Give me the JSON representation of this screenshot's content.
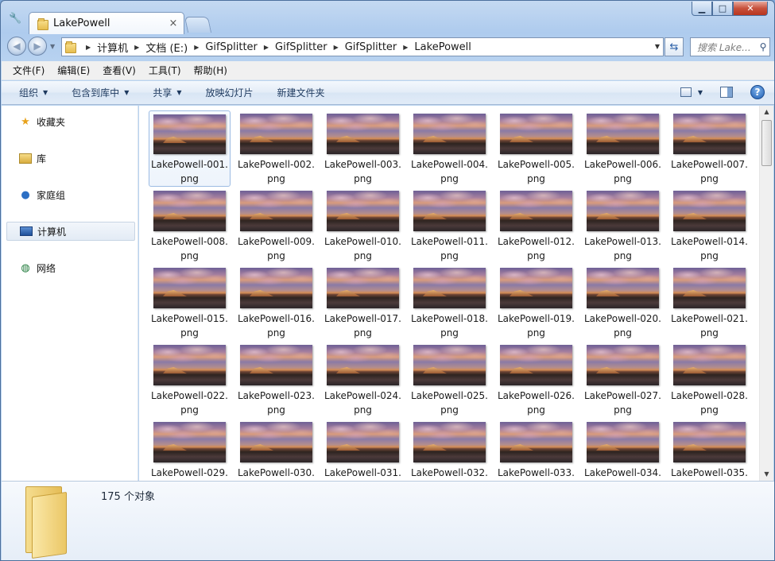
{
  "window": {
    "tab_title": "LakePowell",
    "tab_close": "×",
    "controls": {
      "minimize": "▁",
      "maximize": "□",
      "close": "✕"
    }
  },
  "address": {
    "crumbs": [
      "计算机",
      "文档 (E:)",
      "GifSplitter",
      "GifSplitter",
      "GifSplitter",
      "LakePowell"
    ],
    "search_placeholder": "搜索 Lake..."
  },
  "menu": [
    "文件(F)",
    "编辑(E)",
    "查看(V)",
    "工具(T)",
    "帮助(H)"
  ],
  "commands": [
    {
      "label": "组织",
      "dropdown": true
    },
    {
      "label": "包含到库中",
      "dropdown": true
    },
    {
      "label": "共享",
      "dropdown": true
    },
    {
      "label": "放映幻灯片",
      "dropdown": false
    },
    {
      "label": "新建文件夹",
      "dropdown": false
    }
  ],
  "sidebar": {
    "items": [
      {
        "label": "收藏夹",
        "icon": "star-icon"
      },
      {
        "label": "库",
        "icon": "library-icon"
      },
      {
        "label": "家庭组",
        "icon": "homegroup-icon"
      },
      {
        "label": "计算机",
        "icon": "computer-icon",
        "selected": true
      },
      {
        "label": "网络",
        "icon": "network-icon"
      }
    ]
  },
  "files": {
    "prefix": "LakePowell-",
    "ext_line": "png",
    "names": [
      "LakePowell-001.",
      "LakePowell-002.",
      "LakePowell-003.",
      "LakePowell-004.",
      "LakePowell-005.",
      "LakePowell-006.",
      "LakePowell-007.",
      "LakePowell-008.",
      "LakePowell-009.",
      "LakePowell-010.",
      "LakePowell-011.",
      "LakePowell-012.",
      "LakePowell-013.",
      "LakePowell-014.",
      "LakePowell-015.",
      "LakePowell-016.",
      "LakePowell-017.",
      "LakePowell-018.",
      "LakePowell-019.",
      "LakePowell-020.",
      "LakePowell-021.",
      "LakePowell-022.",
      "LakePowell-023.",
      "LakePowell-024.",
      "LakePowell-025.",
      "LakePowell-026.",
      "LakePowell-027.",
      "LakePowell-028.",
      "LakePowell-029.",
      "LakePowell-030.",
      "LakePowell-031.",
      "LakePowell-032.",
      "LakePowell-033.",
      "LakePowell-034.",
      "LakePowell-035."
    ],
    "selected_index": 0
  },
  "details": {
    "count": "175 个对象"
  }
}
